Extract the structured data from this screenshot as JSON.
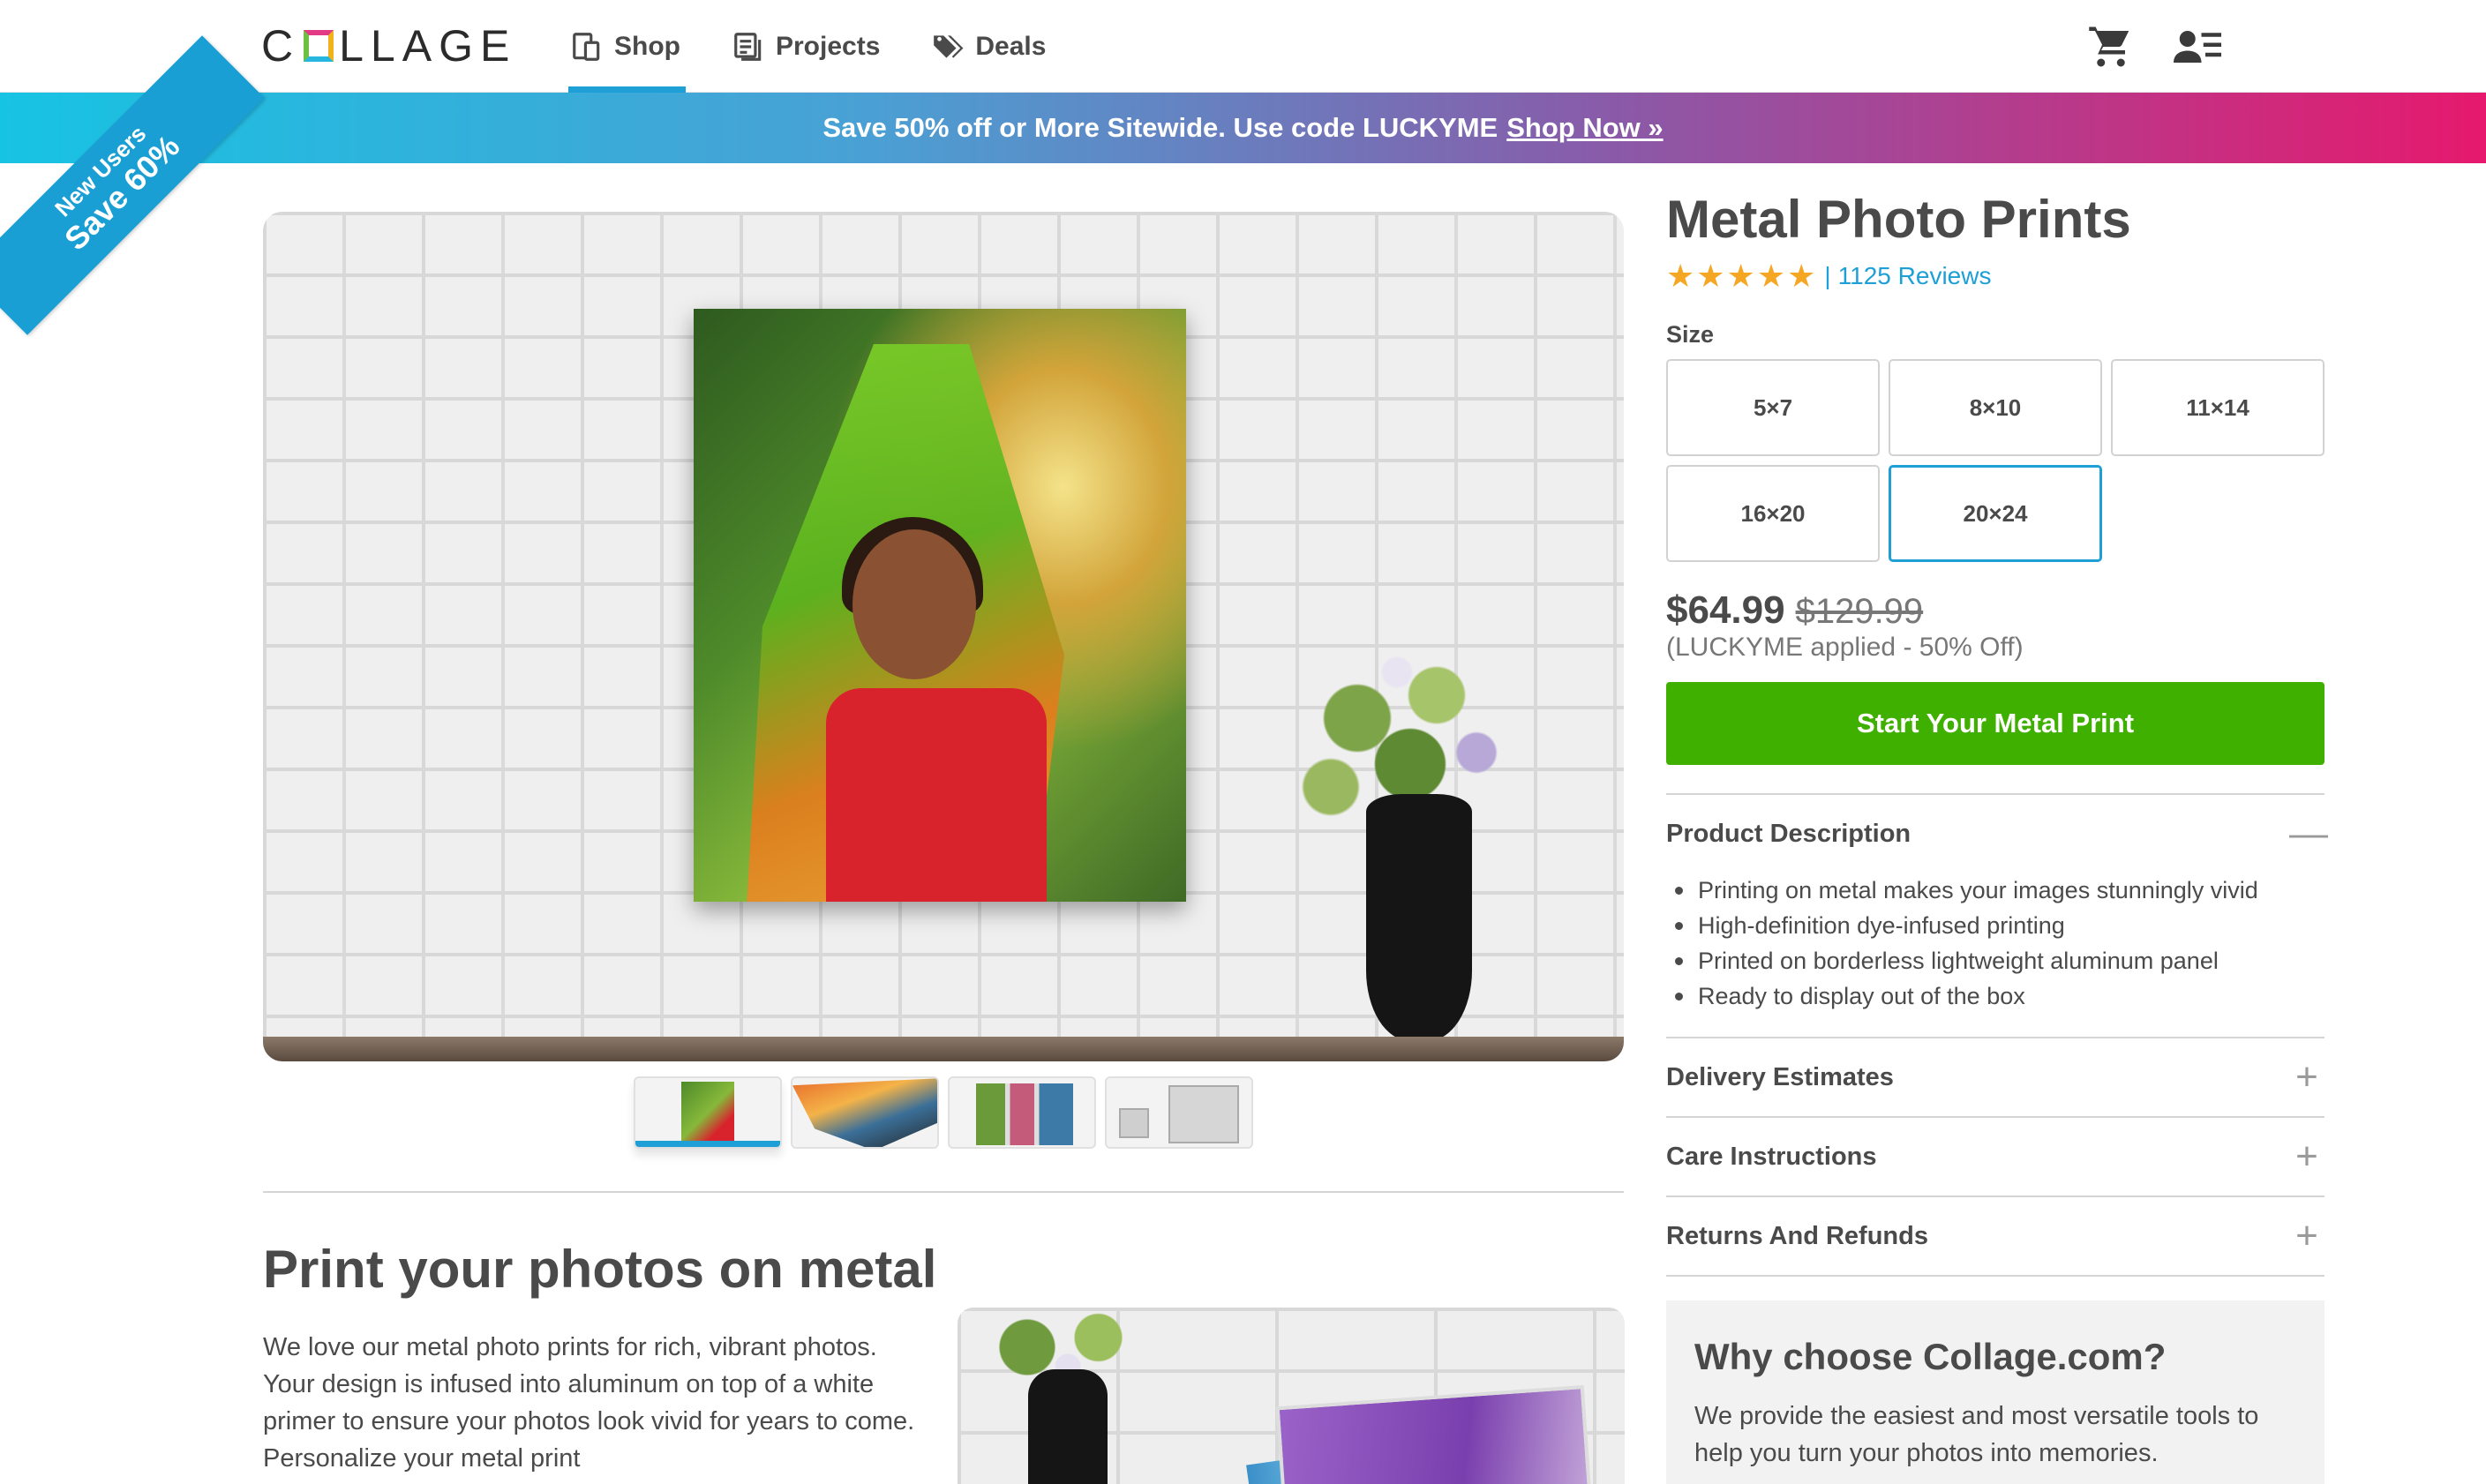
{
  "header": {
    "logo_text": "COLLAGE",
    "nav": [
      {
        "label": "Shop",
        "icon": "shop-icon"
      },
      {
        "label": "Projects",
        "icon": "projects-icon"
      },
      {
        "label": "Deals",
        "icon": "deals-tag-icon"
      }
    ],
    "icons": [
      "cart-icon",
      "account-icon"
    ]
  },
  "promo": {
    "text": "Save 50% off or More Sitewide. Use code LUCKYME",
    "link": "Shop Now »",
    "ribbon_line1": "New Users",
    "ribbon_line2": "Save 60%"
  },
  "product": {
    "title": "Metal Photo Prints",
    "stars": "★★★★★",
    "reviews": "1125 Reviews",
    "size_label": "Size",
    "sizes": [
      "5×7",
      "8×10",
      "11×14",
      "16×20",
      "20×24"
    ],
    "selected_size": "20×24",
    "price": "$64.99",
    "old_price": "$129.99",
    "applied": "(LUCKYME applied - 50% Off)",
    "cta": "Start Your Metal Print"
  },
  "accordion": {
    "description": {
      "title": "Product Description",
      "toggle": "—",
      "bullets": [
        "Printing on metal makes your images stunningly vivid",
        "High-definition dye-infused printing",
        "Printed on borderless lightweight aluminum panel",
        "Ready to display out of the box"
      ]
    },
    "delivery": {
      "title": "Delivery Estimates",
      "toggle": "+"
    },
    "care": {
      "title": "Care Instructions",
      "toggle": "+"
    },
    "returns": {
      "title": "Returns And Refunds",
      "toggle": "+"
    }
  },
  "section": {
    "title": "Print your photos on metal",
    "body": "We love our metal photo prints for rich, vibrant photos. Your design is infused into aluminum on top of a white primer to ensure your photos look vivid for years to come. Personalize your metal print"
  },
  "why": {
    "title": "Why choose Collage.com?",
    "body": "We provide the easiest and most versatile tools to help you turn your photos into memories."
  },
  "colors": {
    "accent": "#1e9fd6",
    "cta": "#3fb000",
    "star": "#f5a623",
    "promo_start": "#17c3e3",
    "promo_end": "#e6196d"
  }
}
